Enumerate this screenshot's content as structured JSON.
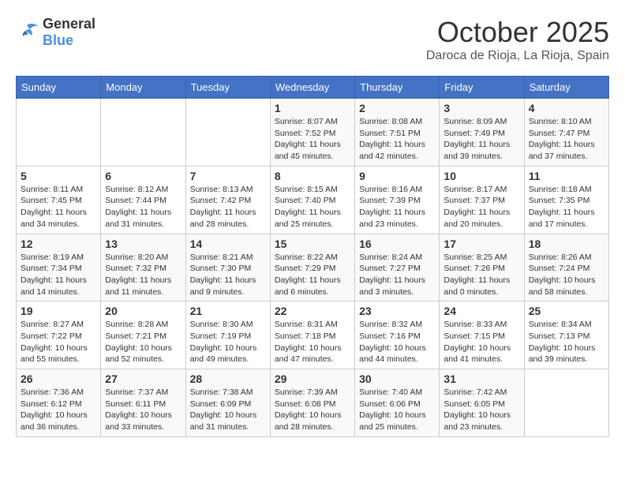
{
  "header": {
    "logo_general": "General",
    "logo_blue": "Blue",
    "month_title": "October 2025",
    "subtitle": "Daroca de Rioja, La Rioja, Spain"
  },
  "weekdays": [
    "Sunday",
    "Monday",
    "Tuesday",
    "Wednesday",
    "Thursday",
    "Friday",
    "Saturday"
  ],
  "weeks": [
    [
      {
        "day": "",
        "info": ""
      },
      {
        "day": "",
        "info": ""
      },
      {
        "day": "",
        "info": ""
      },
      {
        "day": "1",
        "info": "Sunrise: 8:07 AM\nSunset: 7:52 PM\nDaylight: 11 hours and 45 minutes."
      },
      {
        "day": "2",
        "info": "Sunrise: 8:08 AM\nSunset: 7:51 PM\nDaylight: 11 hours and 42 minutes."
      },
      {
        "day": "3",
        "info": "Sunrise: 8:09 AM\nSunset: 7:49 PM\nDaylight: 11 hours and 39 minutes."
      },
      {
        "day": "4",
        "info": "Sunrise: 8:10 AM\nSunset: 7:47 PM\nDaylight: 11 hours and 37 minutes."
      }
    ],
    [
      {
        "day": "5",
        "info": "Sunrise: 8:11 AM\nSunset: 7:45 PM\nDaylight: 11 hours and 34 minutes."
      },
      {
        "day": "6",
        "info": "Sunrise: 8:12 AM\nSunset: 7:44 PM\nDaylight: 11 hours and 31 minutes."
      },
      {
        "day": "7",
        "info": "Sunrise: 8:13 AM\nSunset: 7:42 PM\nDaylight: 11 hours and 28 minutes."
      },
      {
        "day": "8",
        "info": "Sunrise: 8:15 AM\nSunset: 7:40 PM\nDaylight: 11 hours and 25 minutes."
      },
      {
        "day": "9",
        "info": "Sunrise: 8:16 AM\nSunset: 7:39 PM\nDaylight: 11 hours and 23 minutes."
      },
      {
        "day": "10",
        "info": "Sunrise: 8:17 AM\nSunset: 7:37 PM\nDaylight: 11 hours and 20 minutes."
      },
      {
        "day": "11",
        "info": "Sunrise: 8:18 AM\nSunset: 7:35 PM\nDaylight: 11 hours and 17 minutes."
      }
    ],
    [
      {
        "day": "12",
        "info": "Sunrise: 8:19 AM\nSunset: 7:34 PM\nDaylight: 11 hours and 14 minutes."
      },
      {
        "day": "13",
        "info": "Sunrise: 8:20 AM\nSunset: 7:32 PM\nDaylight: 11 hours and 11 minutes."
      },
      {
        "day": "14",
        "info": "Sunrise: 8:21 AM\nSunset: 7:30 PM\nDaylight: 11 hours and 9 minutes."
      },
      {
        "day": "15",
        "info": "Sunrise: 8:22 AM\nSunset: 7:29 PM\nDaylight: 11 hours and 6 minutes."
      },
      {
        "day": "16",
        "info": "Sunrise: 8:24 AM\nSunset: 7:27 PM\nDaylight: 11 hours and 3 minutes."
      },
      {
        "day": "17",
        "info": "Sunrise: 8:25 AM\nSunset: 7:26 PM\nDaylight: 11 hours and 0 minutes."
      },
      {
        "day": "18",
        "info": "Sunrise: 8:26 AM\nSunset: 7:24 PM\nDaylight: 10 hours and 58 minutes."
      }
    ],
    [
      {
        "day": "19",
        "info": "Sunrise: 8:27 AM\nSunset: 7:22 PM\nDaylight: 10 hours and 55 minutes."
      },
      {
        "day": "20",
        "info": "Sunrise: 8:28 AM\nSunset: 7:21 PM\nDaylight: 10 hours and 52 minutes."
      },
      {
        "day": "21",
        "info": "Sunrise: 8:30 AM\nSunset: 7:19 PM\nDaylight: 10 hours and 49 minutes."
      },
      {
        "day": "22",
        "info": "Sunrise: 8:31 AM\nSunset: 7:18 PM\nDaylight: 10 hours and 47 minutes."
      },
      {
        "day": "23",
        "info": "Sunrise: 8:32 AM\nSunset: 7:16 PM\nDaylight: 10 hours and 44 minutes."
      },
      {
        "day": "24",
        "info": "Sunrise: 8:33 AM\nSunset: 7:15 PM\nDaylight: 10 hours and 41 minutes."
      },
      {
        "day": "25",
        "info": "Sunrise: 8:34 AM\nSunset: 7:13 PM\nDaylight: 10 hours and 39 minutes."
      }
    ],
    [
      {
        "day": "26",
        "info": "Sunrise: 7:36 AM\nSunset: 6:12 PM\nDaylight: 10 hours and 36 minutes."
      },
      {
        "day": "27",
        "info": "Sunrise: 7:37 AM\nSunset: 6:11 PM\nDaylight: 10 hours and 33 minutes."
      },
      {
        "day": "28",
        "info": "Sunrise: 7:38 AM\nSunset: 6:09 PM\nDaylight: 10 hours and 31 minutes."
      },
      {
        "day": "29",
        "info": "Sunrise: 7:39 AM\nSunset: 6:08 PM\nDaylight: 10 hours and 28 minutes."
      },
      {
        "day": "30",
        "info": "Sunrise: 7:40 AM\nSunset: 6:06 PM\nDaylight: 10 hours and 25 minutes."
      },
      {
        "day": "31",
        "info": "Sunrise: 7:42 AM\nSunset: 6:05 PM\nDaylight: 10 hours and 23 minutes."
      },
      {
        "day": "",
        "info": ""
      }
    ]
  ]
}
